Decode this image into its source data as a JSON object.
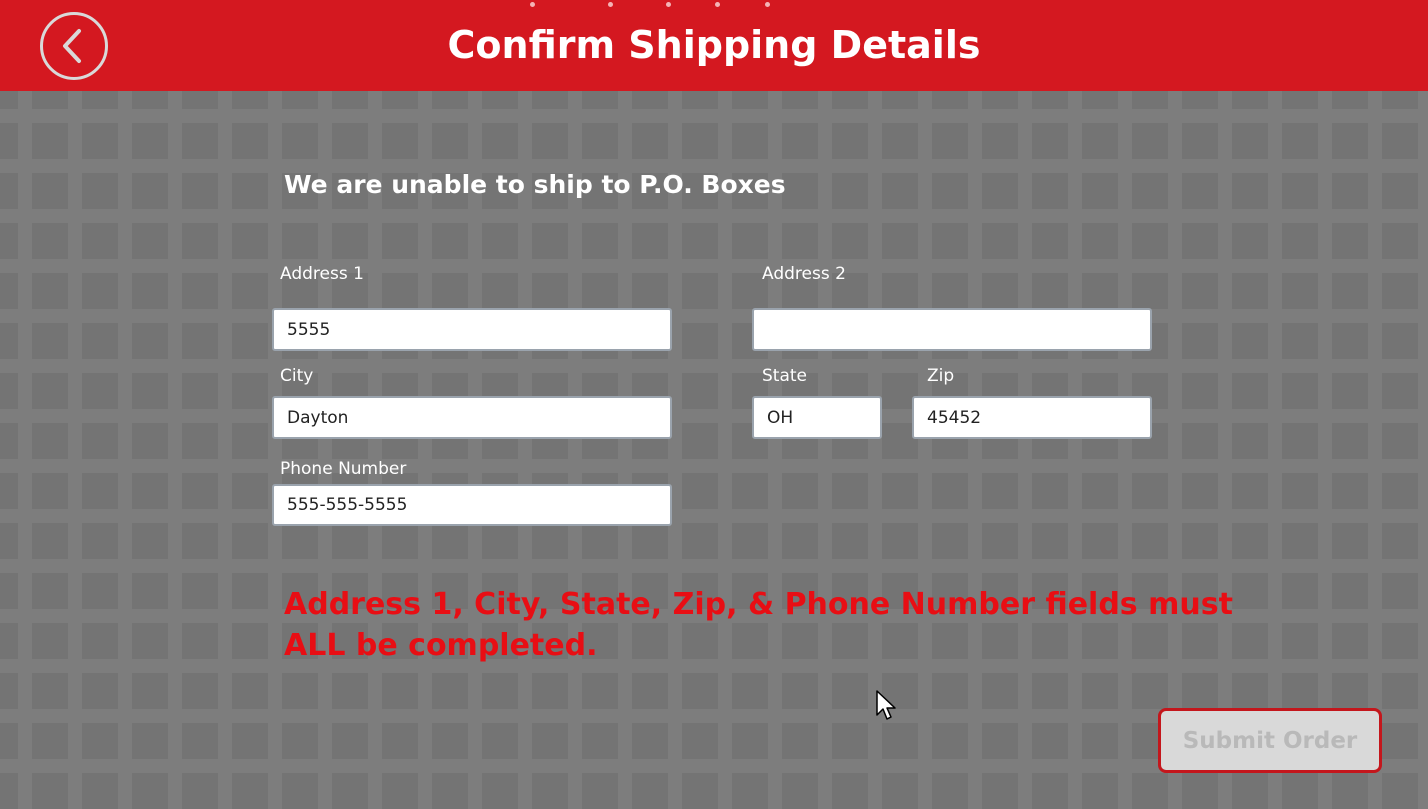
{
  "header": {
    "title": "Confirm Shipping Details",
    "back_icon": "chevron-left-icon"
  },
  "notice": "We are unable to ship to P.O. Boxes",
  "form": {
    "address1": {
      "label": "Address 1",
      "value": "5555"
    },
    "address2": {
      "label": "Address 2",
      "value": ""
    },
    "city": {
      "label": "City",
      "value": "Dayton"
    },
    "state": {
      "label": "State",
      "value": "OH"
    },
    "zip": {
      "label": "Zip",
      "value": "45452"
    },
    "phone": {
      "label": "Phone Number",
      "value": "555-555-5555"
    }
  },
  "error_message": "Address 1, City, State, Zip, & Phone Number fields must ALL be completed.",
  "submit_label": "Submit Order",
  "colors": {
    "header_bg": "#d41820",
    "error_text": "#e80e14",
    "page_bg": "#777777"
  }
}
